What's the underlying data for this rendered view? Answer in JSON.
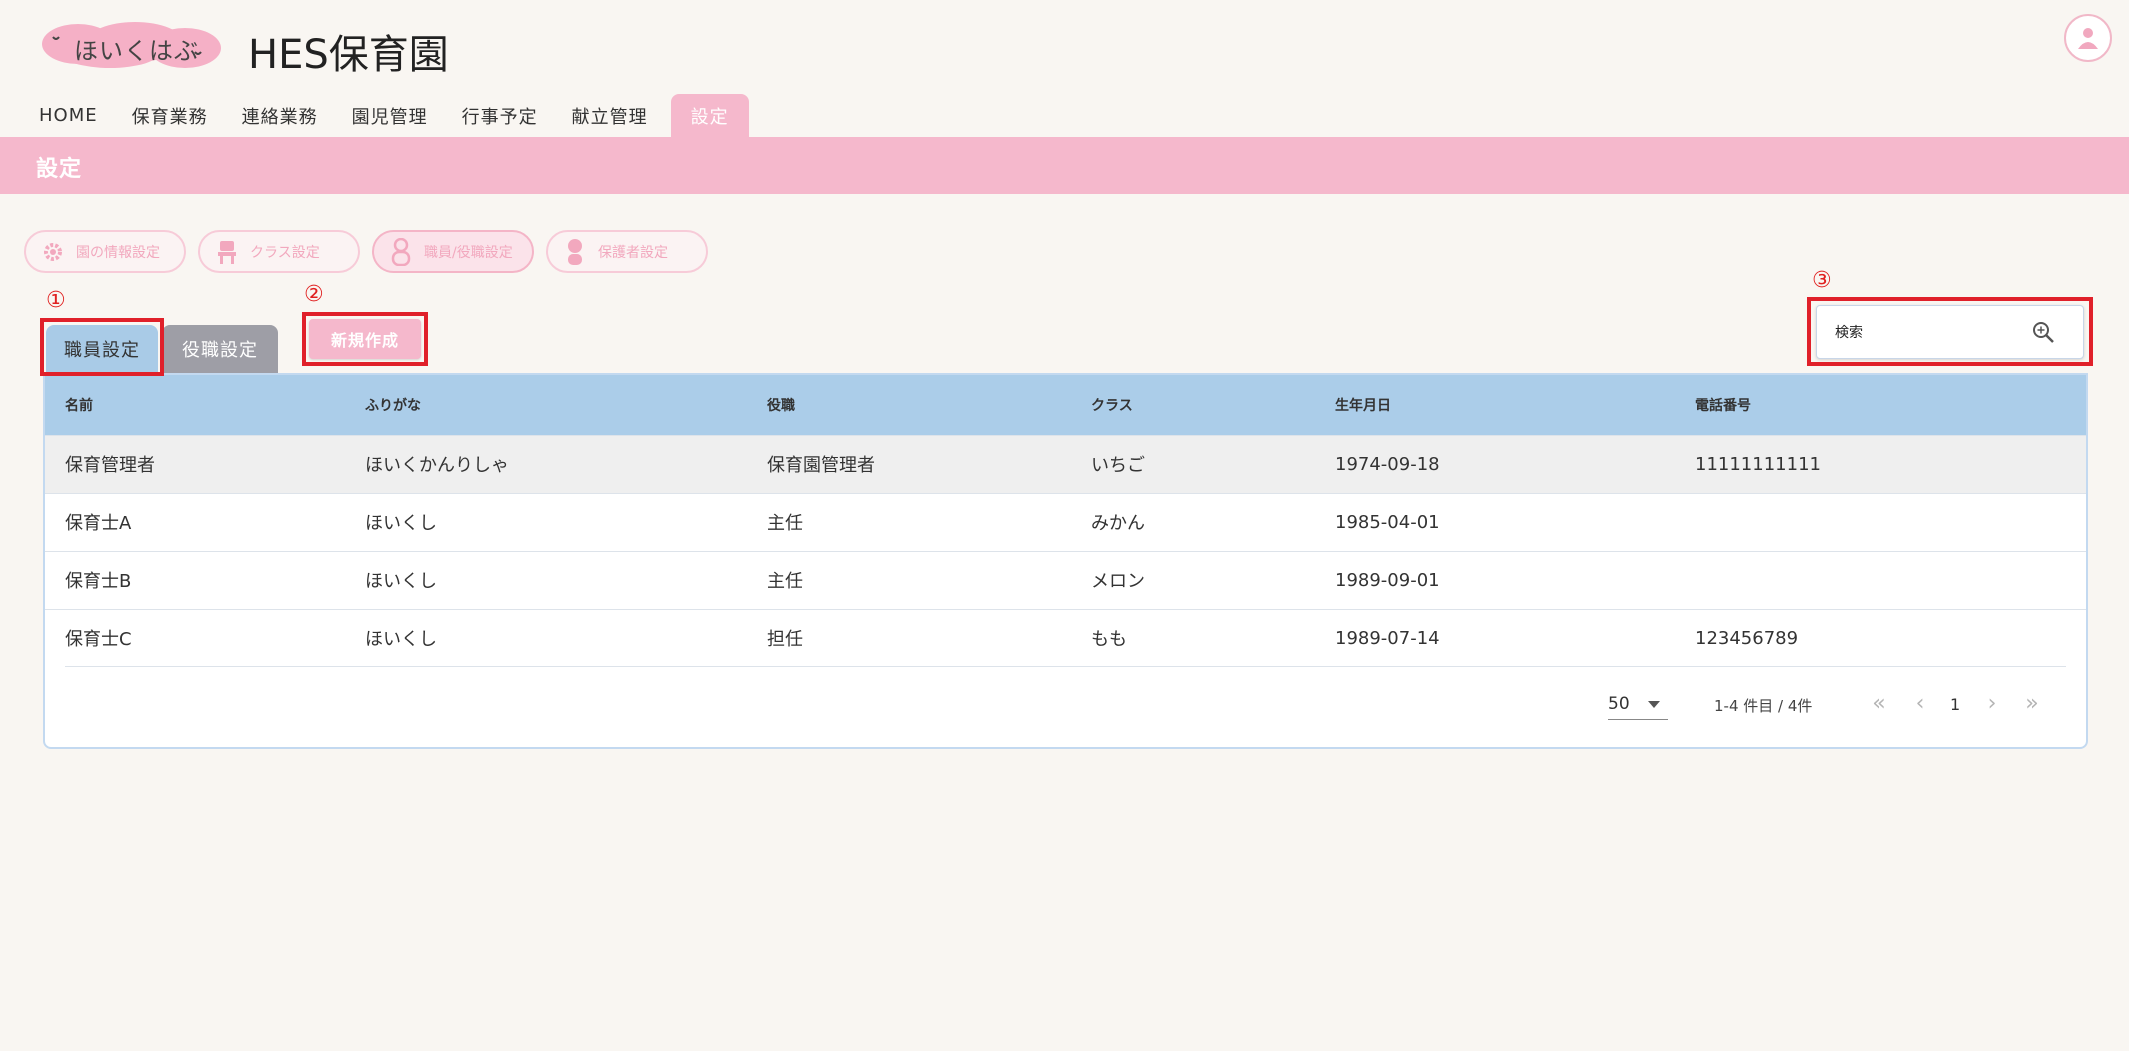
{
  "header": {
    "logo_text": "ほいくはぶ",
    "app_title": "HES保育園"
  },
  "nav": {
    "items": [
      {
        "label": "HOME"
      },
      {
        "label": "保育業務"
      },
      {
        "label": "連絡業務"
      },
      {
        "label": "園児管理"
      },
      {
        "label": "行事予定"
      },
      {
        "label": "献立管理"
      },
      {
        "label": "設定"
      }
    ],
    "active_index": 6
  },
  "banner": {
    "title": "設定"
  },
  "settings_menu": {
    "items": [
      {
        "label": "園の情報設定",
        "icon": "gear-icon"
      },
      {
        "label": "クラス設定",
        "icon": "chair-icon"
      },
      {
        "label": "職員/役職設定",
        "icon": "staff-icon"
      },
      {
        "label": "保護者設定",
        "icon": "guardian-icon"
      }
    ],
    "active_index": 2
  },
  "annotations": [
    "①",
    "②",
    "③"
  ],
  "tabs": [
    {
      "label": "職員設定"
    },
    {
      "label": "役職設定"
    }
  ],
  "new_button": {
    "label": "新規作成"
  },
  "search": {
    "placeholder": "検索"
  },
  "table": {
    "columns": [
      "名前",
      "ふりがな",
      "役職",
      "クラス",
      "生年月日",
      "電話番号"
    ],
    "rows": [
      [
        "保育管理者",
        "ほいくかんりしゃ",
        "保育園管理者",
        "いちご",
        "1974-09-18",
        "11111111111"
      ],
      [
        "保育士A",
        "ほいくし",
        "主任",
        "みかん",
        "1985-04-01",
        ""
      ],
      [
        "保育士B",
        "ほいくし",
        "主任",
        "メロン",
        "1989-09-01",
        ""
      ],
      [
        "保育士C",
        "ほいくし",
        "担任",
        "もも",
        "1989-07-14",
        "123456789"
      ]
    ]
  },
  "pagination": {
    "per_page": "50",
    "range_text": "1-4 件目 / 4件",
    "current_page": "1"
  },
  "colors": {
    "accent_pink": "#f5b8cc",
    "table_header_blue": "#abcde9",
    "annotation_red": "#e0202a"
  }
}
